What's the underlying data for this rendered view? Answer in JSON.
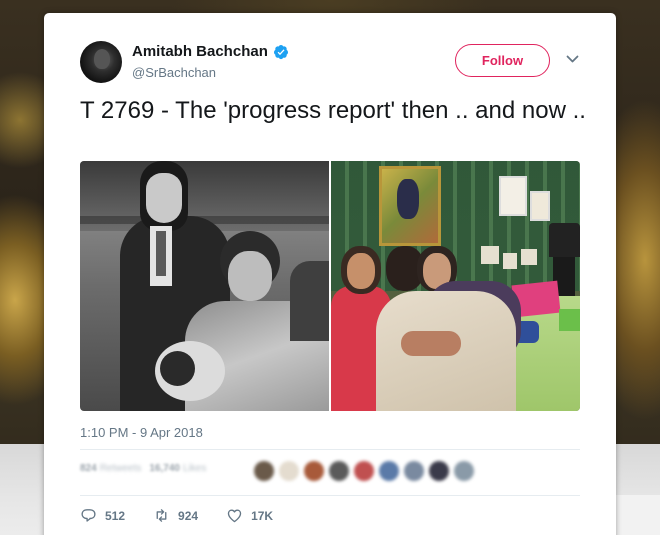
{
  "tweet": {
    "author": {
      "display_name": "Amitabh Bachchan",
      "handle": "@SrBachchan",
      "verified": true
    },
    "follow_label": "Follow",
    "text": "T 2769 - The 'progress report' then .. and now ..",
    "timestamp": "1:10 PM - 9 Apr 2018",
    "stats": {
      "retweets_count": "824",
      "retweets_label": "Retweets",
      "likes_count": "16,740",
      "likes_label": "Likes"
    },
    "actions": {
      "replies": "512",
      "retweets": "924",
      "likes": "17K"
    }
  },
  "colors": {
    "accent": "#e0245e",
    "verified": "#1da1f2",
    "muted_text": "#657786",
    "body_text": "#14171a"
  },
  "icons": [
    "verified-badge-icon",
    "chevron-down-icon",
    "reply-icon",
    "retweet-icon",
    "like-icon"
  ]
}
